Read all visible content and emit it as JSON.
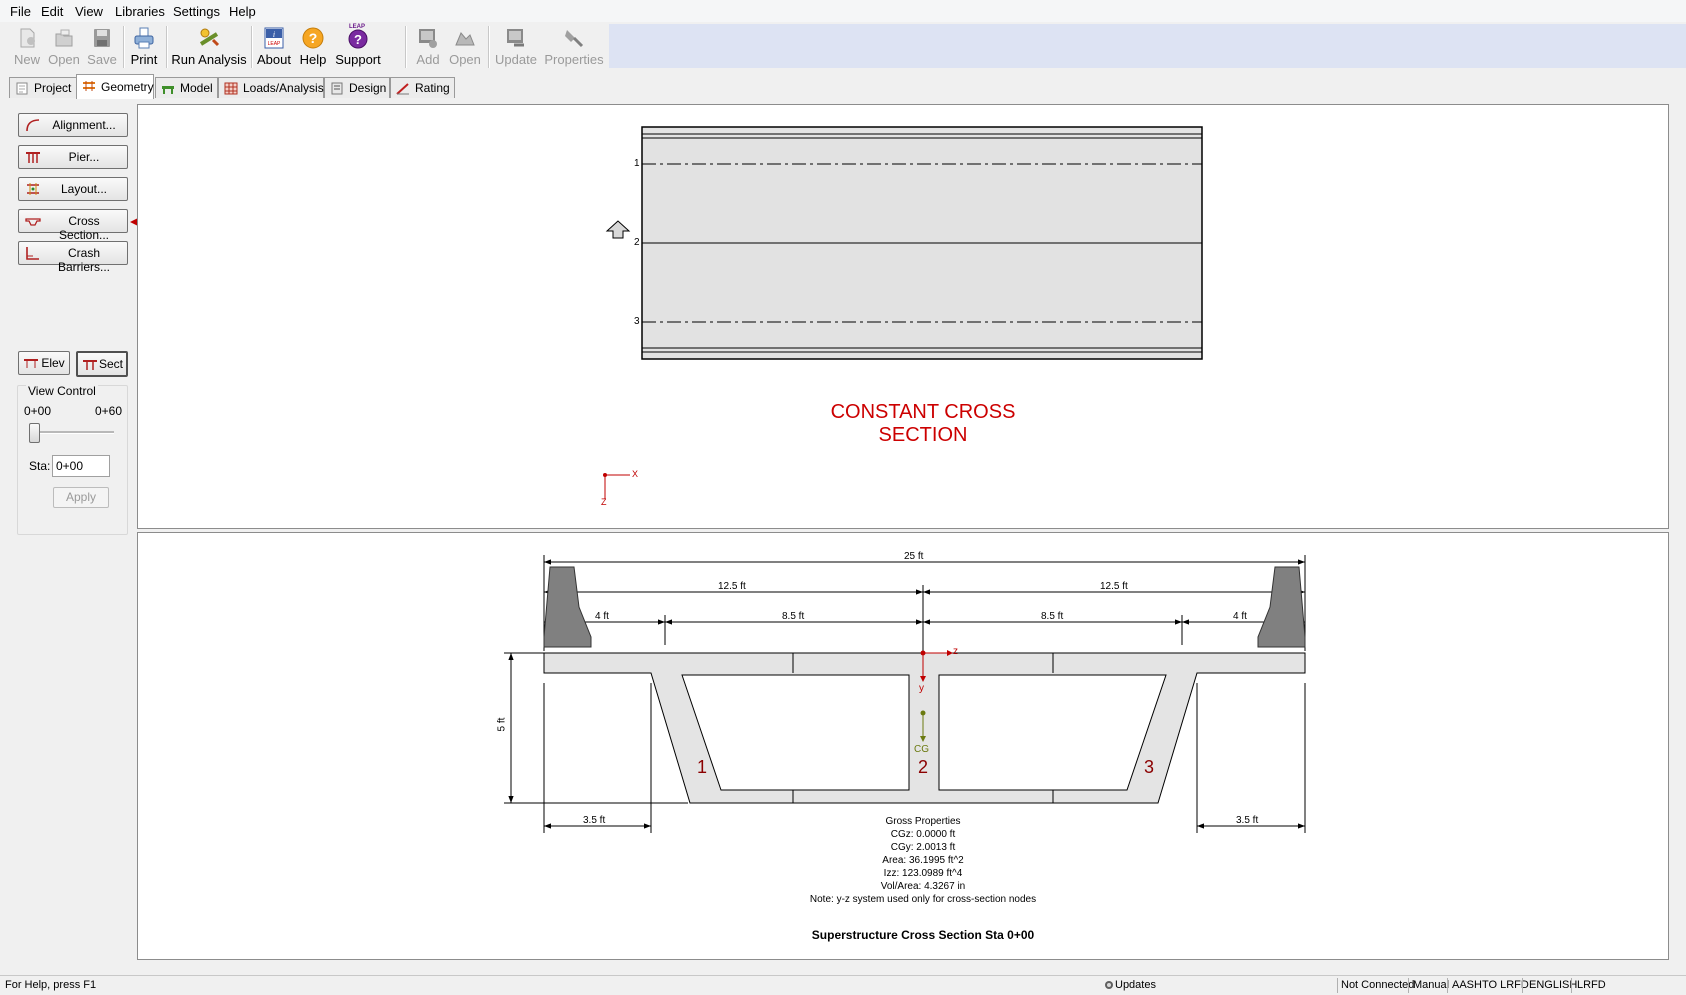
{
  "menu": [
    "File",
    "Edit",
    "View",
    "Libraries",
    "Settings",
    "Help"
  ],
  "toolbar": {
    "new": "New",
    "open": "Open",
    "save": "Save",
    "print": "Print",
    "run_analysis": "Run Analysis",
    "about": "About",
    "help": "Help",
    "support": "Support",
    "add": "Add",
    "open2": "Open",
    "update": "Update",
    "properties": "Properties",
    "leap_badge": "LEAP"
  },
  "tabs": [
    "Project",
    "Geometry",
    "Model",
    "Loads/Analysis",
    "Design",
    "Rating"
  ],
  "left": {
    "alignment": "Alignment...",
    "pier": "Pier...",
    "layout": "Layout...",
    "cross_section": "Cross Section...",
    "crash_barriers": "Crash Barriers...",
    "elev": "Elev",
    "sect": "Sect"
  },
  "view_control": {
    "title": "View Control",
    "min": "0+00",
    "max": "0+60",
    "slider_value": 0,
    "sta_label": "Sta:",
    "sta_value": "0+00",
    "apply": "Apply"
  },
  "plan": {
    "girders": [
      "1",
      "2",
      "3"
    ],
    "caption": "CONSTANT CROSS SECTION",
    "axis_x": "X",
    "axis_z": "Z"
  },
  "section": {
    "dim_total": "25 ft",
    "dim_half_left": "12.5 ft",
    "dim_half_right": "12.5 ft",
    "dim_left_4": "4 ft",
    "dim_left_85": "8.5 ft",
    "dim_right_85": "8.5 ft",
    "dim_right_4": "4 ft",
    "dim_depth": "5 ft",
    "dim_overhang_left": "3.5 ft",
    "dim_overhang_right": "3.5 ft",
    "web_labels": [
      "1",
      "2",
      "3"
    ],
    "axis_z": "z",
    "axis_y": "y",
    "cg": "CG",
    "props_title": "Gross Properties",
    "props": [
      "CGz:  0.0000 ft",
      "CGy:  2.0013 ft",
      "Area:  36.1995 ft^2",
      "Izz:  123.0989 ft^4",
      "Vol/Area:  4.3267 in",
      "Note: y-z system used only for cross-section nodes"
    ],
    "title": "Superstructure Cross Section Sta 0+00"
  },
  "status": {
    "help": "For Help, press F1",
    "updates": "Updates",
    "connection": "Not Connected",
    "mode": "Manual",
    "code": "AASHTO LRFD",
    "units": "ENGLISH",
    "method": "LRFD"
  },
  "colors": {
    "accent_red": "#cc0000",
    "section_fill": "#e4e4e4",
    "barrier_fill": "#808080"
  }
}
